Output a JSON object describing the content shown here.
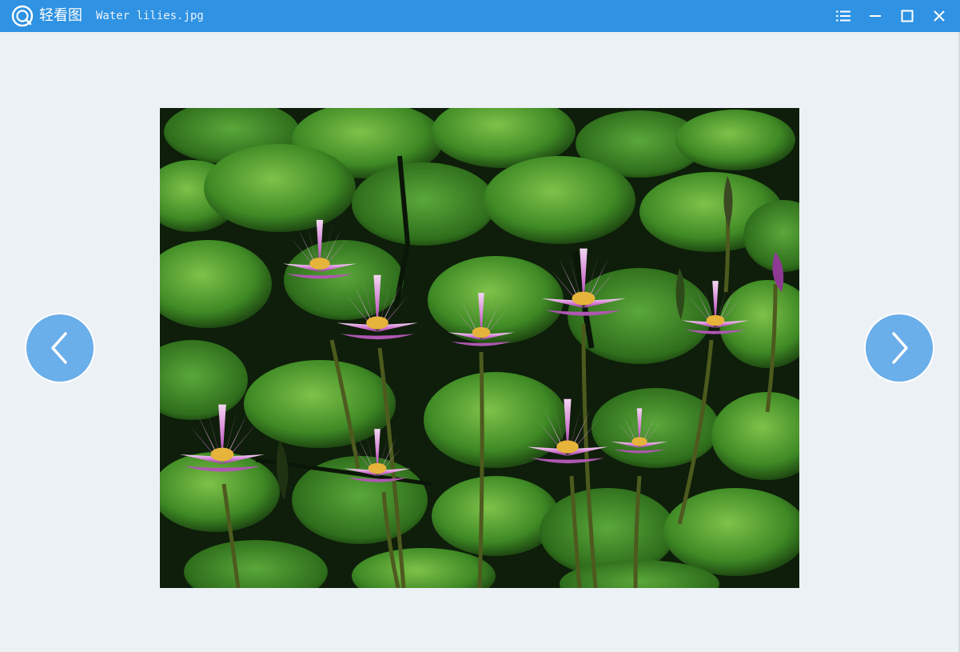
{
  "titlebar": {
    "app_name": "轻看图",
    "file_name": "Water lilies.jpg",
    "menu_icon": "list-menu-icon",
    "minimize_icon": "minimize-icon",
    "maximize_icon": "maximize-icon",
    "close_icon": "close-icon"
  },
  "viewer": {
    "image_subject": "pink water lilies among green lily pads",
    "prev_icon": "chevron-left-icon",
    "next_icon": "chevron-right-icon"
  },
  "colors": {
    "titlebar": "#2f92e2",
    "background": "#ecf1f6",
    "nav_button": "#6aaeea"
  }
}
